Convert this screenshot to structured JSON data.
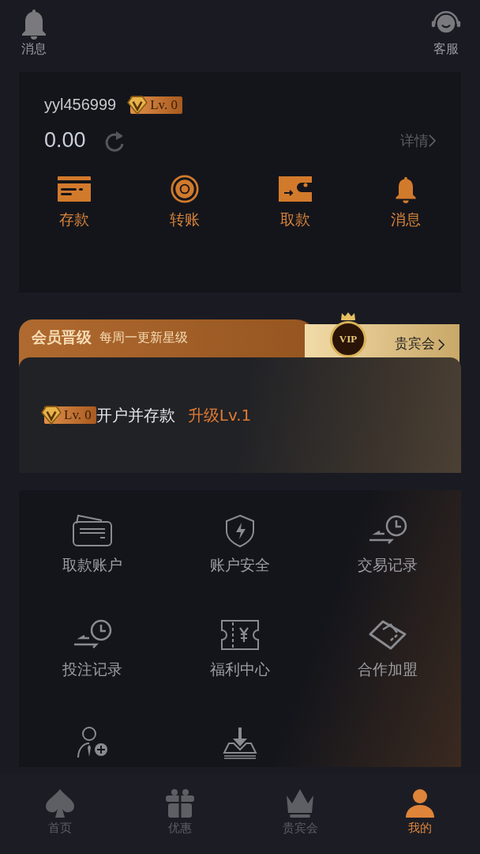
{
  "header": {
    "left_label": "消息",
    "right_label": "客服"
  },
  "account": {
    "username": "yyl456999",
    "level_badge": "Lv. 0",
    "balance": "0.00",
    "details_link": "详情",
    "actions": [
      {
        "label": "存款"
      },
      {
        "label": "转账"
      },
      {
        "label": "取款"
      },
      {
        "label": "消息"
      }
    ]
  },
  "vip": {
    "title": "会员晋级",
    "subtitle": "每周一更新星级",
    "club_link": "贵宾会",
    "vip_emblem": "VIP",
    "level_badge": "Lv. 0",
    "requirement": "开户并存款",
    "next_level": "升级Lv.1"
  },
  "menu": [
    {
      "label": "取款账户"
    },
    {
      "label": "账户安全"
    },
    {
      "label": "交易记录"
    },
    {
      "label": "投注记录"
    },
    {
      "label": "福利中心"
    },
    {
      "label": "合作加盟"
    }
  ],
  "tabs": [
    {
      "label": "首页",
      "selected": false
    },
    {
      "label": "优惠",
      "selected": false
    },
    {
      "label": "贵宾会",
      "selected": false
    },
    {
      "label": "我的",
      "selected": true
    }
  ]
}
